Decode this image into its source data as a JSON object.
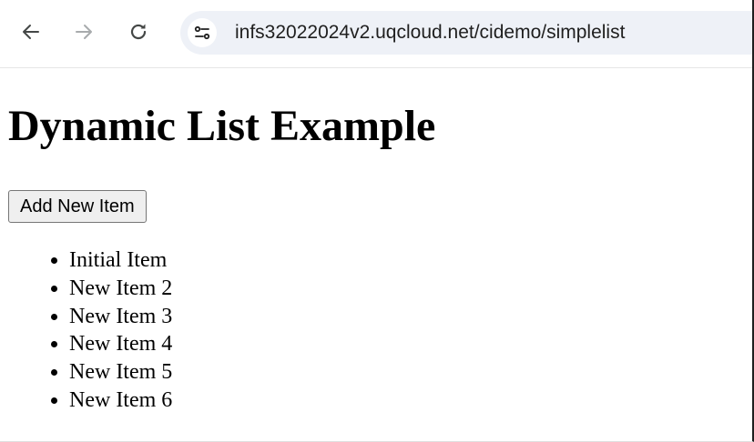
{
  "browser": {
    "back_icon": "arrow-left-icon",
    "forward_icon": "arrow-right-icon",
    "reload_icon": "reload-icon",
    "site_info_icon": "tune-icon",
    "url": "infs32022024v2.uqcloud.net/cidemo/simplelist"
  },
  "page": {
    "title": "Dynamic List Example",
    "add_button_label": "Add New Item",
    "items": [
      {
        "label": "Initial Item"
      },
      {
        "label": "New Item 2"
      },
      {
        "label": "New Item 3"
      },
      {
        "label": "New Item 4"
      },
      {
        "label": "New Item 5"
      },
      {
        "label": "New Item 6"
      }
    ]
  }
}
